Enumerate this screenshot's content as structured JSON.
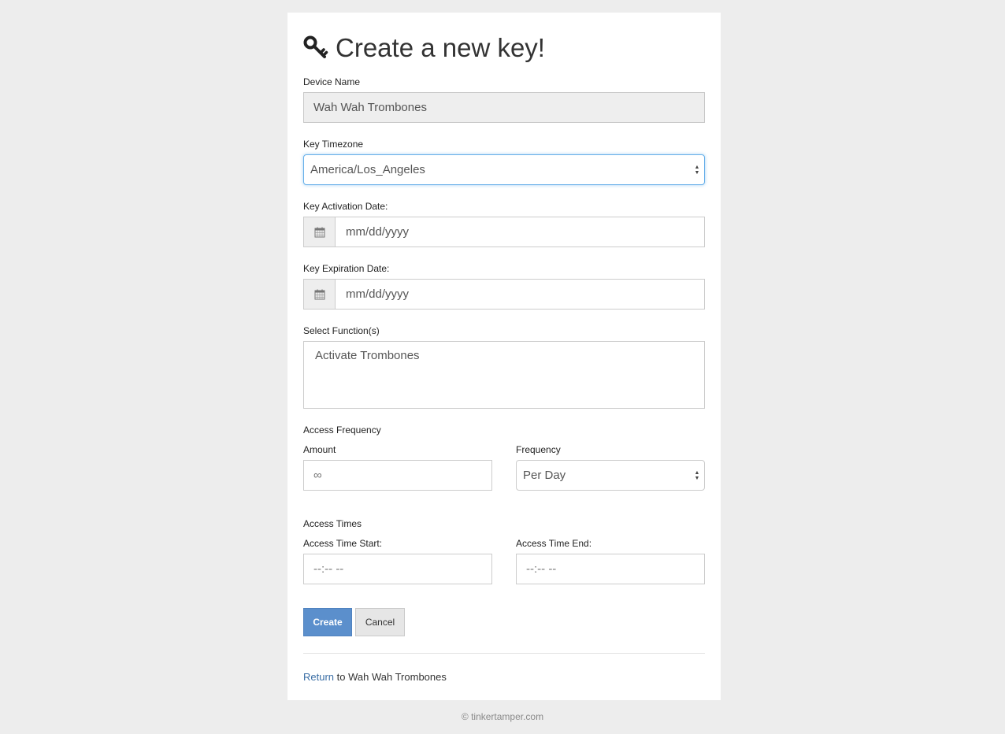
{
  "header": {
    "title": "Create a new key!",
    "icon": "key-icon"
  },
  "form": {
    "device_name": {
      "label": "Device Name",
      "value": "Wah Wah Trombones"
    },
    "timezone": {
      "label": "Key Timezone",
      "value": "America/Los_Angeles"
    },
    "activation_date": {
      "label": "Key Activation Date:",
      "placeholder": "mm/dd/yyyy",
      "icon": "calendar-icon"
    },
    "expiration_date": {
      "label": "Key Expiration Date:",
      "placeholder": "mm/dd/yyyy",
      "icon": "calendar-icon"
    },
    "functions": {
      "label": "Select Function(s)",
      "options": [
        "Activate Trombones"
      ]
    },
    "access_frequency": {
      "section_label": "Access Frequency",
      "amount_label": "Amount",
      "amount_placeholder": "∞",
      "frequency_label": "Frequency",
      "frequency_value": "Per Day"
    },
    "access_times": {
      "section_label": "Access Times",
      "start_label": "Access Time Start:",
      "start_placeholder": "--:-- --",
      "end_label": "Access Time End:",
      "end_placeholder": "--:-- --"
    }
  },
  "actions": {
    "create_label": "Create",
    "cancel_label": "Cancel"
  },
  "return": {
    "link_text": "Return",
    "suffix": "to Wah Wah Trombones"
  },
  "footer": {
    "text": "© tinkertamper.com"
  },
  "colors": {
    "background": "#ededed",
    "primary_button": "#5b8fcc",
    "link": "#3a6ea5",
    "focus_border": "#66afe9"
  }
}
